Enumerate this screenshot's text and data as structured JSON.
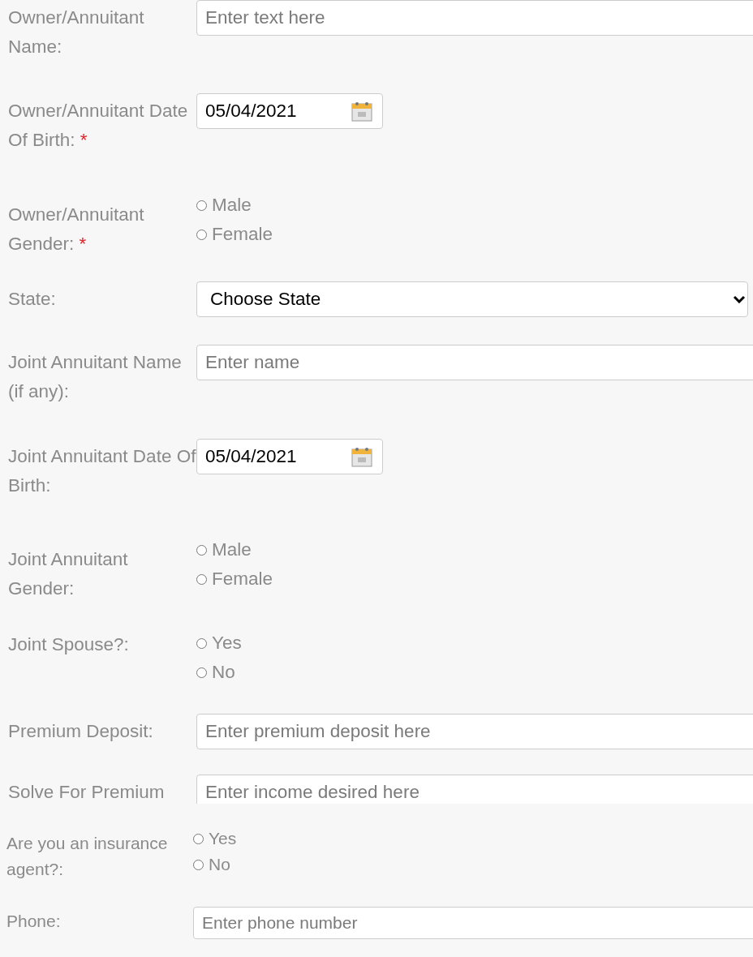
{
  "fields": [
    {
      "kind": "text",
      "label": "Owner/Annuitant Name:",
      "placeholder": "Enter text here"
    },
    {
      "kind": "date",
      "label": "Owner/Annuitant Date Of Birth:",
      "required_mark": "*",
      "value": "05/04/2021"
    },
    {
      "kind": "radio",
      "label": "Owner/Annuitant Gender:",
      "required_mark": "*",
      "options": [
        {
          "label": "Male",
          "selected": false
        },
        {
          "label": "Female",
          "selected": false
        }
      ]
    },
    {
      "kind": "select",
      "label": "State:",
      "value": "Choose State"
    },
    {
      "kind": "text",
      "label": "Joint Annuitant Name (if any):",
      "placeholder": "Enter name"
    },
    {
      "kind": "date",
      "label": "Joint Annuitant Date Of Birth:",
      "value": "05/04/2021"
    },
    {
      "kind": "radio",
      "label": "Joint Annuitant Gender:",
      "options": [
        {
          "label": "Male",
          "selected": false
        },
        {
          "label": "Female",
          "selected": false
        }
      ]
    },
    {
      "kind": "radio",
      "label": "Joint Spouse?:",
      "options": [
        {
          "label": "Yes",
          "selected": false
        },
        {
          "label": "No",
          "selected": false
        }
      ]
    },
    {
      "kind": "text",
      "label": "Premium Deposit:",
      "placeholder": "Enter premium deposit here"
    },
    {
      "kind": "text",
      "label": "Solve For Premium",
      "placeholder": "Enter income desired here"
    },
    {
      "kind": "radio",
      "label": "Are you an insurance agent?:",
      "options": [
        {
          "label": "Yes",
          "selected": false
        },
        {
          "label": "No",
          "selected": false
        }
      ]
    },
    {
      "kind": "text",
      "label": "Phone:",
      "placeholder": "Enter phone number"
    }
  ]
}
